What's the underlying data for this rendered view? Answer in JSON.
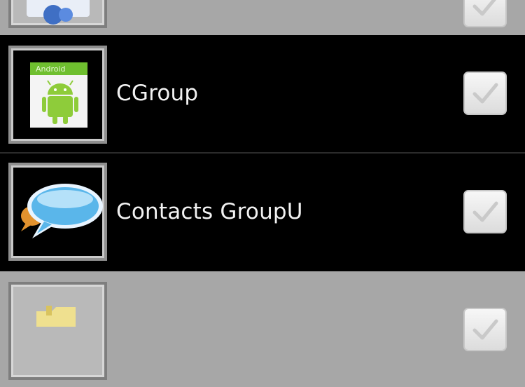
{
  "groups": [
    {
      "name": "",
      "icon": "group-photo-icon",
      "checked": false
    },
    {
      "name": "CGroup",
      "icon": "android-icon",
      "checked": false
    },
    {
      "name": "Contacts GroupU",
      "icon": "chat-bubble-icon",
      "checked": false
    },
    {
      "name": "",
      "icon": "folder-icon",
      "checked": false
    }
  ],
  "colors": {
    "selected_row": "#a7a7a7",
    "row": "#000000",
    "label_text": "#f2f2f2"
  }
}
